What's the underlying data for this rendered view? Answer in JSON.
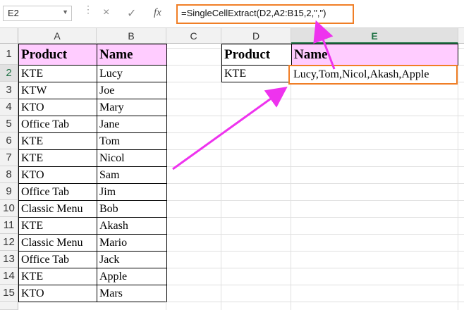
{
  "formula_bar": {
    "name_box": "E2",
    "cancel_icon": "×",
    "enter_icon": "✓",
    "fx_icon": "fx",
    "formula": "=SingleCellExtract(D2,A2:B15,2,\",\")"
  },
  "columns": [
    "A",
    "B",
    "C",
    "D",
    "E"
  ],
  "rows": [
    "1",
    "2",
    "3",
    "4",
    "5",
    "6",
    "7",
    "8",
    "9",
    "10",
    "11",
    "12",
    "13",
    "14",
    "15"
  ],
  "table": {
    "headers": [
      "Product",
      "Name"
    ],
    "rows": [
      [
        "KTE",
        "Lucy"
      ],
      [
        "KTW",
        "Joe"
      ],
      [
        "KTO",
        "Mary"
      ],
      [
        "Office Tab",
        "Jane"
      ],
      [
        "KTE",
        "Tom"
      ],
      [
        "KTE",
        "Nicol"
      ],
      [
        "KTO",
        "Sam"
      ],
      [
        "Office Tab",
        "Jim"
      ],
      [
        "Classic Menu",
        "Bob"
      ],
      [
        "KTE",
        "Akash"
      ],
      [
        "Classic Menu",
        "Mario"
      ],
      [
        "Office Tab",
        "Jack"
      ],
      [
        "KTE",
        "Apple"
      ],
      [
        "KTO",
        "Mars"
      ]
    ]
  },
  "result": {
    "headers": [
      "Product",
      "Name"
    ],
    "product": "KTE",
    "names": "Lucy,Tom,Nicol,Akash,Apple"
  },
  "colors": {
    "header_fill": "#ffccff",
    "highlight": "#f07e26",
    "arrow": "#ee33ee",
    "selection": "#217346"
  }
}
